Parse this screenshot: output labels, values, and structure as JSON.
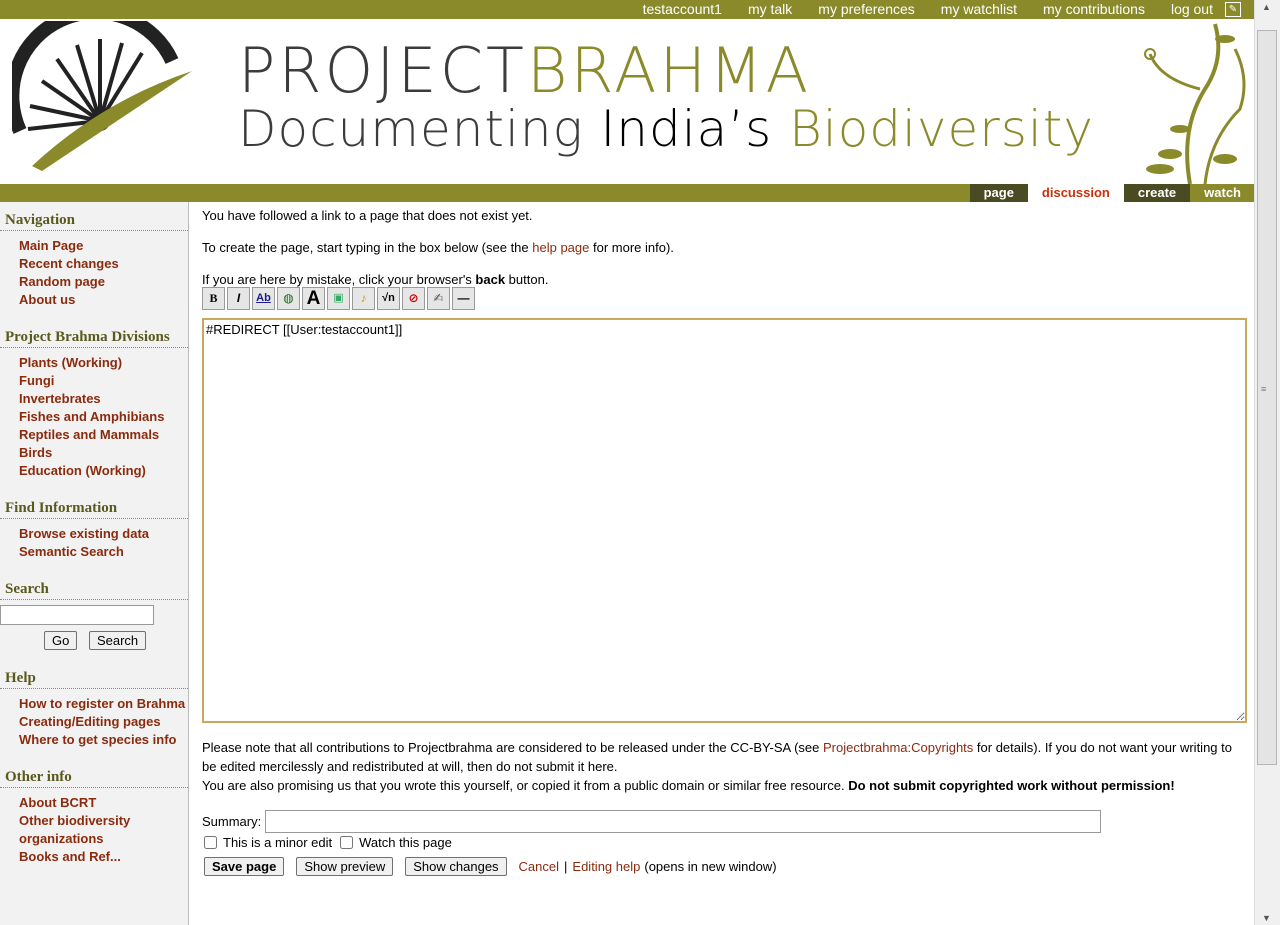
{
  "topbar": {
    "items": [
      "testaccount1",
      "my talk",
      "my preferences",
      "my watchlist",
      "my contributions",
      "log out"
    ]
  },
  "header": {
    "title_part1": "PROJECT",
    "title_part2": "BRAHMA",
    "tagline_part1": "Documenting ",
    "tagline_part2": "India’s ",
    "tagline_part3": "Biodiversity",
    "brand_color": "#8b8a2b"
  },
  "tabs": [
    "page",
    "discussion",
    "create",
    "watch"
  ],
  "sidebar": {
    "navigation": {
      "title": "Navigation",
      "items": [
        "Main Page",
        "Recent changes",
        "Random page",
        "About us"
      ]
    },
    "divisions": {
      "title": "Project Brahma Divisions",
      "items": [
        "Plants (Working)",
        "Fungi",
        "Invertebrates",
        "Fishes and Amphibians",
        "Reptiles and Mammals",
        "Birds",
        "Education (Working)"
      ]
    },
    "find": {
      "title": "Find Information",
      "items": [
        "Browse existing data",
        "Semantic Search"
      ]
    },
    "search": {
      "title": "Search",
      "go_label": "Go",
      "search_label": "Search",
      "value": ""
    },
    "help": {
      "title": "Help",
      "items": [
        "How to register on Brahma",
        "Creating/Editing pages",
        "Where to get species info"
      ]
    },
    "other": {
      "title": "Other info",
      "items": [
        "About BCRT",
        "Other biodiversity organizations",
        "Books and Ref..."
      ]
    }
  },
  "content": {
    "msg1": "You have followed a link to a page that does not exist yet.",
    "msg2_pre": "To create the page, start typing in the box below (see the ",
    "msg2_link": "help page",
    "msg2_post": " for more info).",
    "msg3_pre": "If you are here by mistake, click your browser's ",
    "msg3_bold": "back",
    "msg3_post": " button.",
    "editor_text": "#REDIRECT [[User:testaccount1]]",
    "copyright_pre": "Please note that all contributions to Projectbrahma are considered to be released under the CC-BY-SA (see ",
    "copyright_link": "Projectbrahma:Copyrights",
    "copyright_post": " for details). If you do not want your writing to be edited mercilessly and redistributed at will, then do not submit it here.",
    "copyright_line2": "You are also promising us that you wrote this yourself, or copied it from a public domain or similar free resource. ",
    "copyright_bold": "Do not submit copyrighted work without permission!",
    "summary_label": "Summary:",
    "summary_value": "",
    "minor_edit_label": "This is a minor edit",
    "watch_label": "Watch this page",
    "save_label": "Save page",
    "preview_label": "Show preview",
    "changes_label": "Show changes",
    "cancel_label": "Cancel",
    "sep": "|",
    "editing_help_label": "Editing help",
    "new_window_note": "(opens in new window)"
  },
  "toolbar_icons": [
    "bold-icon",
    "italic-icon",
    "internal-link-icon",
    "external-link-icon",
    "headline-icon",
    "image-icon",
    "media-icon",
    "math-icon",
    "nowiki-icon",
    "signature-icon",
    "horizontal-line-icon"
  ]
}
